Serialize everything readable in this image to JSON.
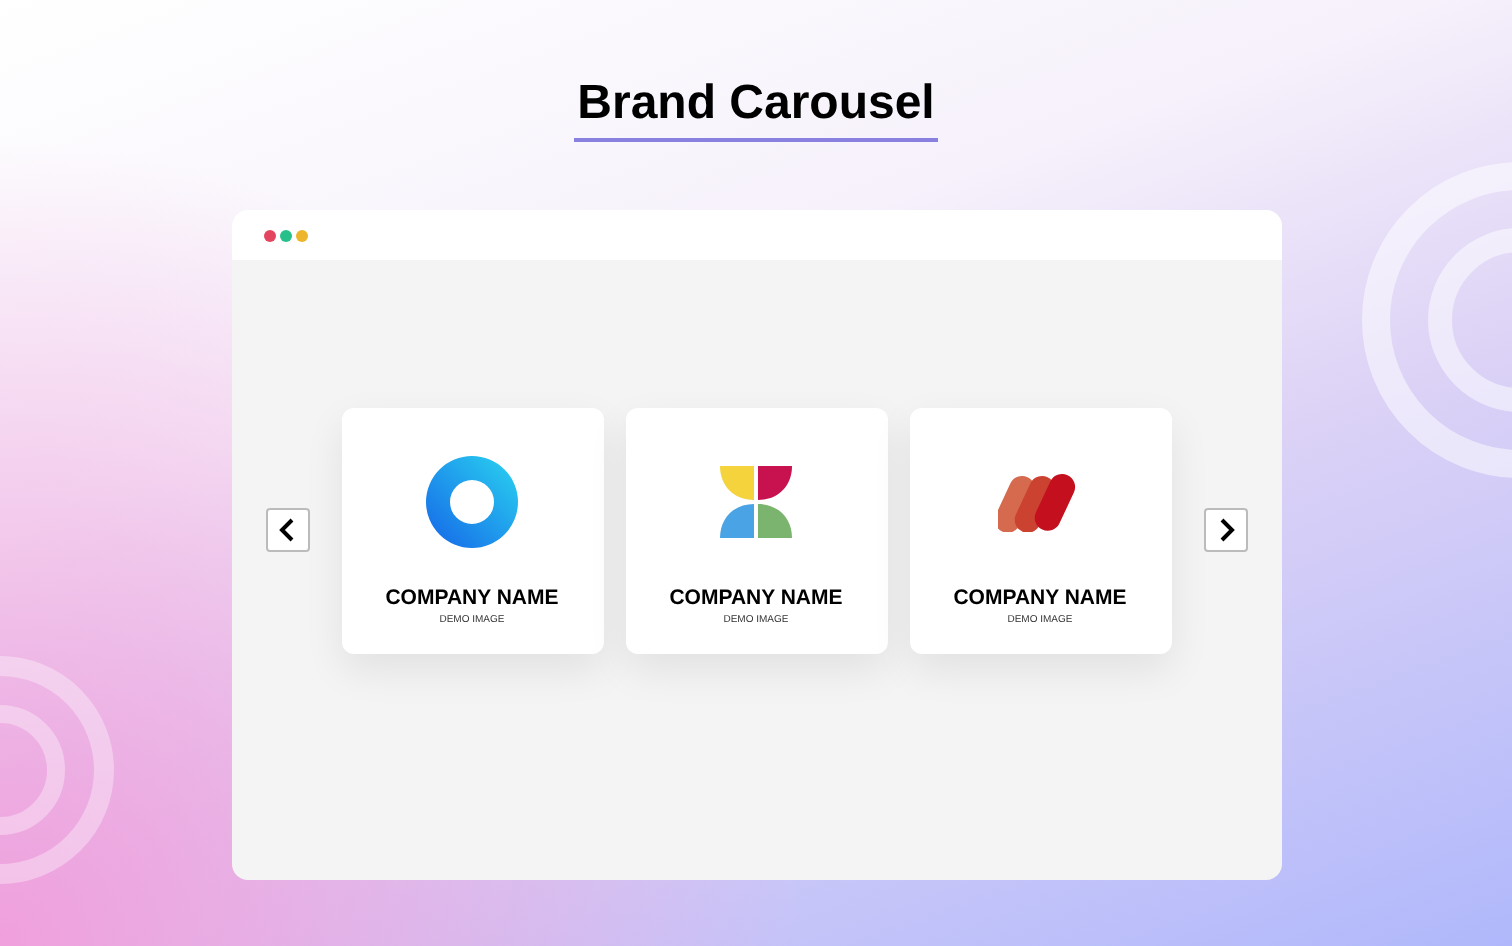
{
  "title": "Brand Carousel",
  "cards": [
    {
      "kind": "ring",
      "name": "COMPANY NAME",
      "caption": "DEMO IMAGE"
    },
    {
      "kind": "petals",
      "name": "COMPANY NAME",
      "caption": "DEMO IMAGE"
    },
    {
      "kind": "leaves",
      "name": "COMPANY NAME",
      "caption": "DEMO IMAGE"
    }
  ]
}
